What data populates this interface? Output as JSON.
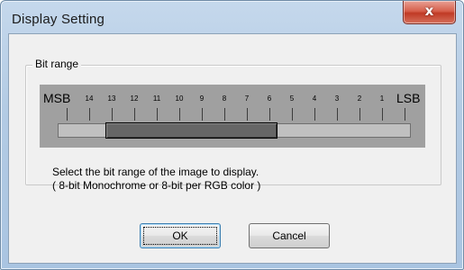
{
  "window": {
    "title": "Display Setting"
  },
  "titlebar": {
    "close_glyph": "x"
  },
  "group": {
    "legend": "Bit range"
  },
  "bit_range": {
    "msb_label": "MSB",
    "lsb_label": "LSB",
    "bits": [
      "14",
      "13",
      "12",
      "11",
      "10",
      "9",
      "8",
      "7",
      "6",
      "5",
      "4",
      "3",
      "2",
      "1"
    ],
    "selected_high_bit": 13,
    "selected_low_bit": 6
  },
  "description": {
    "line1": "Select the bit range of the image to display.",
    "line2": "( 8-bit Monochrome or 8-bit per RGB color )"
  },
  "buttons": {
    "ok": "OK",
    "cancel": "Cancel"
  },
  "colors": {
    "titlebar": "#b9cfe7",
    "panel": "#a0a0a0",
    "thumb": "#666666",
    "close": "#c8402c"
  }
}
